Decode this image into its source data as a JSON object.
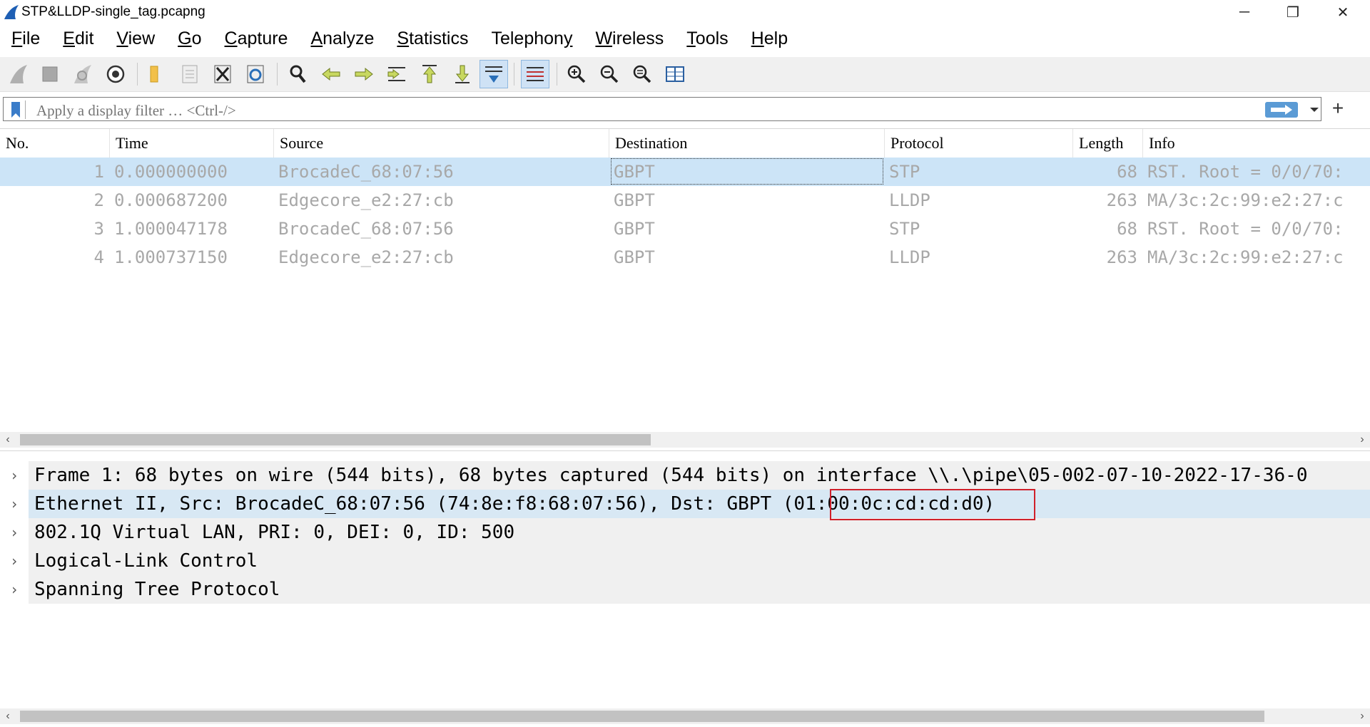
{
  "window": {
    "title": "STP&LLDP-single_tag.pcapng",
    "minimize": "─",
    "restore": "❐",
    "close": "✕"
  },
  "menu": [
    {
      "pre": "",
      "u": "F",
      "post": "ile"
    },
    {
      "pre": "",
      "u": "E",
      "post": "dit"
    },
    {
      "pre": "",
      "u": "V",
      "post": "iew"
    },
    {
      "pre": "",
      "u": "G",
      "post": "o"
    },
    {
      "pre": "",
      "u": "C",
      "post": "apture"
    },
    {
      "pre": "",
      "u": "A",
      "post": "nalyze"
    },
    {
      "pre": "",
      "u": "S",
      "post": "tatistics"
    },
    {
      "pre": "Telephon",
      "u": "y",
      "post": ""
    },
    {
      "pre": "",
      "u": "W",
      "post": "ireless"
    },
    {
      "pre": "",
      "u": "T",
      "post": "ools"
    },
    {
      "pre": "",
      "u": "H",
      "post": "elp"
    }
  ],
  "filter": {
    "placeholder": "Apply a display filter … <Ctrl-/>",
    "plus": "+"
  },
  "packet_list": {
    "columns": [
      "No.",
      "Time",
      "Source",
      "Destination",
      "Protocol",
      "Length",
      "Info"
    ],
    "rows": [
      {
        "no": "1",
        "time": "0.000000000",
        "source": "BrocadeC_68:07:56",
        "destination": "GBPT",
        "protocol": "STP",
        "length": "68",
        "info": "RST. Root = 0/0/70:"
      },
      {
        "no": "2",
        "time": "0.000687200",
        "source": "Edgecore_e2:27:cb",
        "destination": "GBPT",
        "protocol": "LLDP",
        "length": "263",
        "info": "MA/3c:2c:99:e2:27:c"
      },
      {
        "no": "3",
        "time": "1.000047178",
        "source": "BrocadeC_68:07:56",
        "destination": "GBPT",
        "protocol": "STP",
        "length": "68",
        "info": "RST. Root = 0/0/70:"
      },
      {
        "no": "4",
        "time": "1.000737150",
        "source": "Edgecore_e2:27:cb",
        "destination": "GBPT",
        "protocol": "LLDP",
        "length": "263",
        "info": "MA/3c:2c:99:e2:27:c"
      }
    ],
    "selected_row": 1
  },
  "details": {
    "rows": [
      "Frame 1: 68 bytes on wire (544 bits), 68 bytes captured (544 bits) on interface \\\\.\\pipe\\05-002-07-10-2022-17-36-0",
      "Ethernet II, Src: BrocadeC_68:07:56 (74:8e:f8:68:07:56), Dst: GBPT (01:00:0c:cd:cd:d0)",
      "802.1Q Virtual LAN, PRI: 0, DEI: 0, ID: 500",
      "Logical-Link Control",
      "Spanning Tree Protocol"
    ],
    "selected_row": 2,
    "chevron": "›"
  },
  "scroll": {
    "left": "‹",
    "right": "›"
  },
  "colors": {
    "selection": "#cce4f7",
    "highlight_box": "#d0202a",
    "filter_apply": "#5b9bd5"
  }
}
